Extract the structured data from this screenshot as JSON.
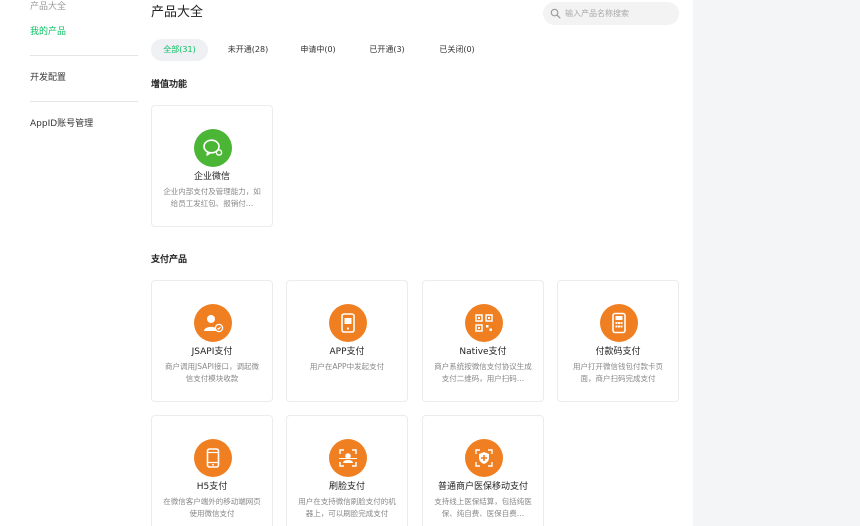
{
  "sidebar": {
    "items": [
      {
        "label": "产品大全",
        "state": "muted"
      },
      {
        "label": "我的产品",
        "state": "active"
      },
      {
        "label": "开发配置",
        "state": "normal"
      },
      {
        "label": "AppID账号管理",
        "state": "normal"
      }
    ]
  },
  "header": {
    "title": "产品大全",
    "search": {
      "placeholder": "输入产品名称搜索",
      "value": "",
      "icon": "search-icon"
    }
  },
  "tabs": [
    {
      "label": "全部(31)",
      "active": true
    },
    {
      "label": "未开通(28)",
      "active": false
    },
    {
      "label": "申请中(0)",
      "active": false
    },
    {
      "label": "已开通(3)",
      "active": false
    },
    {
      "label": "已关闭(0)",
      "active": false
    }
  ],
  "sections": [
    {
      "title": "增值功能",
      "cards": [
        {
          "name": "企业微信",
          "desc": "企业内部支付及管理能力，如给员工发红包、报销付…",
          "icon": "wecom-icon",
          "color": "#4bb535"
        }
      ]
    },
    {
      "title": "支付产品",
      "cards": [
        {
          "name": "JSAPI支付",
          "desc": "商户调用JSAPI接口，调起微信支付模块收款",
          "icon": "jsapi-pay-icon",
          "color": "#f07f22"
        },
        {
          "name": "APP支付",
          "desc": "用户在APP中发起支付",
          "icon": "app-pay-icon",
          "color": "#f07f22"
        },
        {
          "name": "Native支付",
          "desc": "商户系统按微信支付协议生成支付二维码，用户扫码…",
          "icon": "qrcode-icon",
          "color": "#f07f22"
        },
        {
          "name": "付款码支付",
          "desc": "用户打开微信钱包付款卡页面，商户扫码完成支付",
          "icon": "pos-terminal-icon",
          "color": "#f07f22"
        },
        {
          "name": "H5支付",
          "desc": "在微信客户端外的移动端网页使用微信支付",
          "icon": "mobile-icon",
          "color": "#f07f22"
        },
        {
          "name": "刷脸支付",
          "desc": "用户在支持微信刷脸支付的机器上，可以刷脸完成支付",
          "icon": "face-scan-icon",
          "color": "#f07f22"
        },
        {
          "name": "普通商户医保移动支付",
          "desc": "支持线上医保结算，包括纯医保、纯自费、医保自费…",
          "icon": "medical-shield-icon",
          "color": "#f07f22"
        }
      ]
    }
  ]
}
